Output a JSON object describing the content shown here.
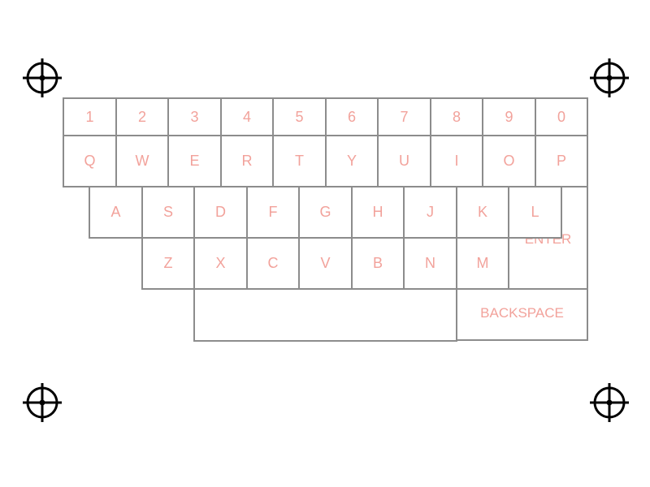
{
  "keyboard": {
    "number_row": [
      "1",
      "2",
      "3",
      "4",
      "5",
      "6",
      "7",
      "8",
      "9",
      "0"
    ],
    "top_row": [
      "Q",
      "W",
      "E",
      "R",
      "T",
      "Y",
      "U",
      "I",
      "O",
      "P"
    ],
    "home_row": [
      "A",
      "S",
      "D",
      "F",
      "G",
      "H",
      "J",
      "K",
      "L"
    ],
    "bottom_row": [
      "Z",
      "X",
      "C",
      "V",
      "B",
      "N",
      "M"
    ],
    "enter_label": "ENTER",
    "space_label": "",
    "backspace_label": "BACKSPACE"
  },
  "colors": {
    "key_text": "#f2a29b",
    "key_border": "#8c8c8c",
    "crosshair": "#000000"
  },
  "icons": {
    "calibration_marker": "crosshair-icon"
  }
}
